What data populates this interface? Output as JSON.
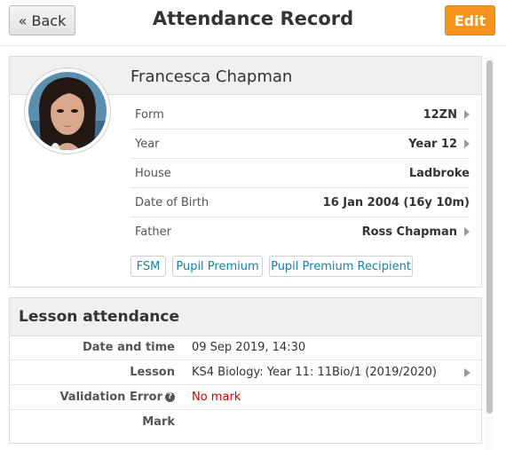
{
  "header": {
    "back_label": "« Back",
    "title": "Attendance Record",
    "edit_label": "Edit"
  },
  "student": {
    "name": "Francesca Chapman",
    "fields": [
      {
        "label": "Form",
        "value": "12ZN"
      },
      {
        "label": "Year",
        "value": "Year 12"
      },
      {
        "label": "House",
        "value": "Ladbroke"
      },
      {
        "label": "Date of Birth",
        "value": "16 Jan 2004 (16y 10m)"
      },
      {
        "label": "Father",
        "value": "Ross Chapman"
      }
    ],
    "tags": [
      "FSM",
      "Pupil Premium",
      "Pupil Premium Recipient"
    ]
  },
  "lesson": {
    "title": "Lesson attendance",
    "rows": [
      {
        "label": "Date and time",
        "value": "09 Sep 2019, 14:30"
      },
      {
        "label": "Lesson",
        "value": "KS4 Biology: Year 11: 11Bio/1 (2019/2020)"
      },
      {
        "label": "Validation Error",
        "value": "No mark"
      },
      {
        "label": "Mark",
        "value": ""
      }
    ]
  },
  "colors": {
    "accent": "#f7941d",
    "link": "#1a7fa0",
    "error": "#cc0000"
  }
}
